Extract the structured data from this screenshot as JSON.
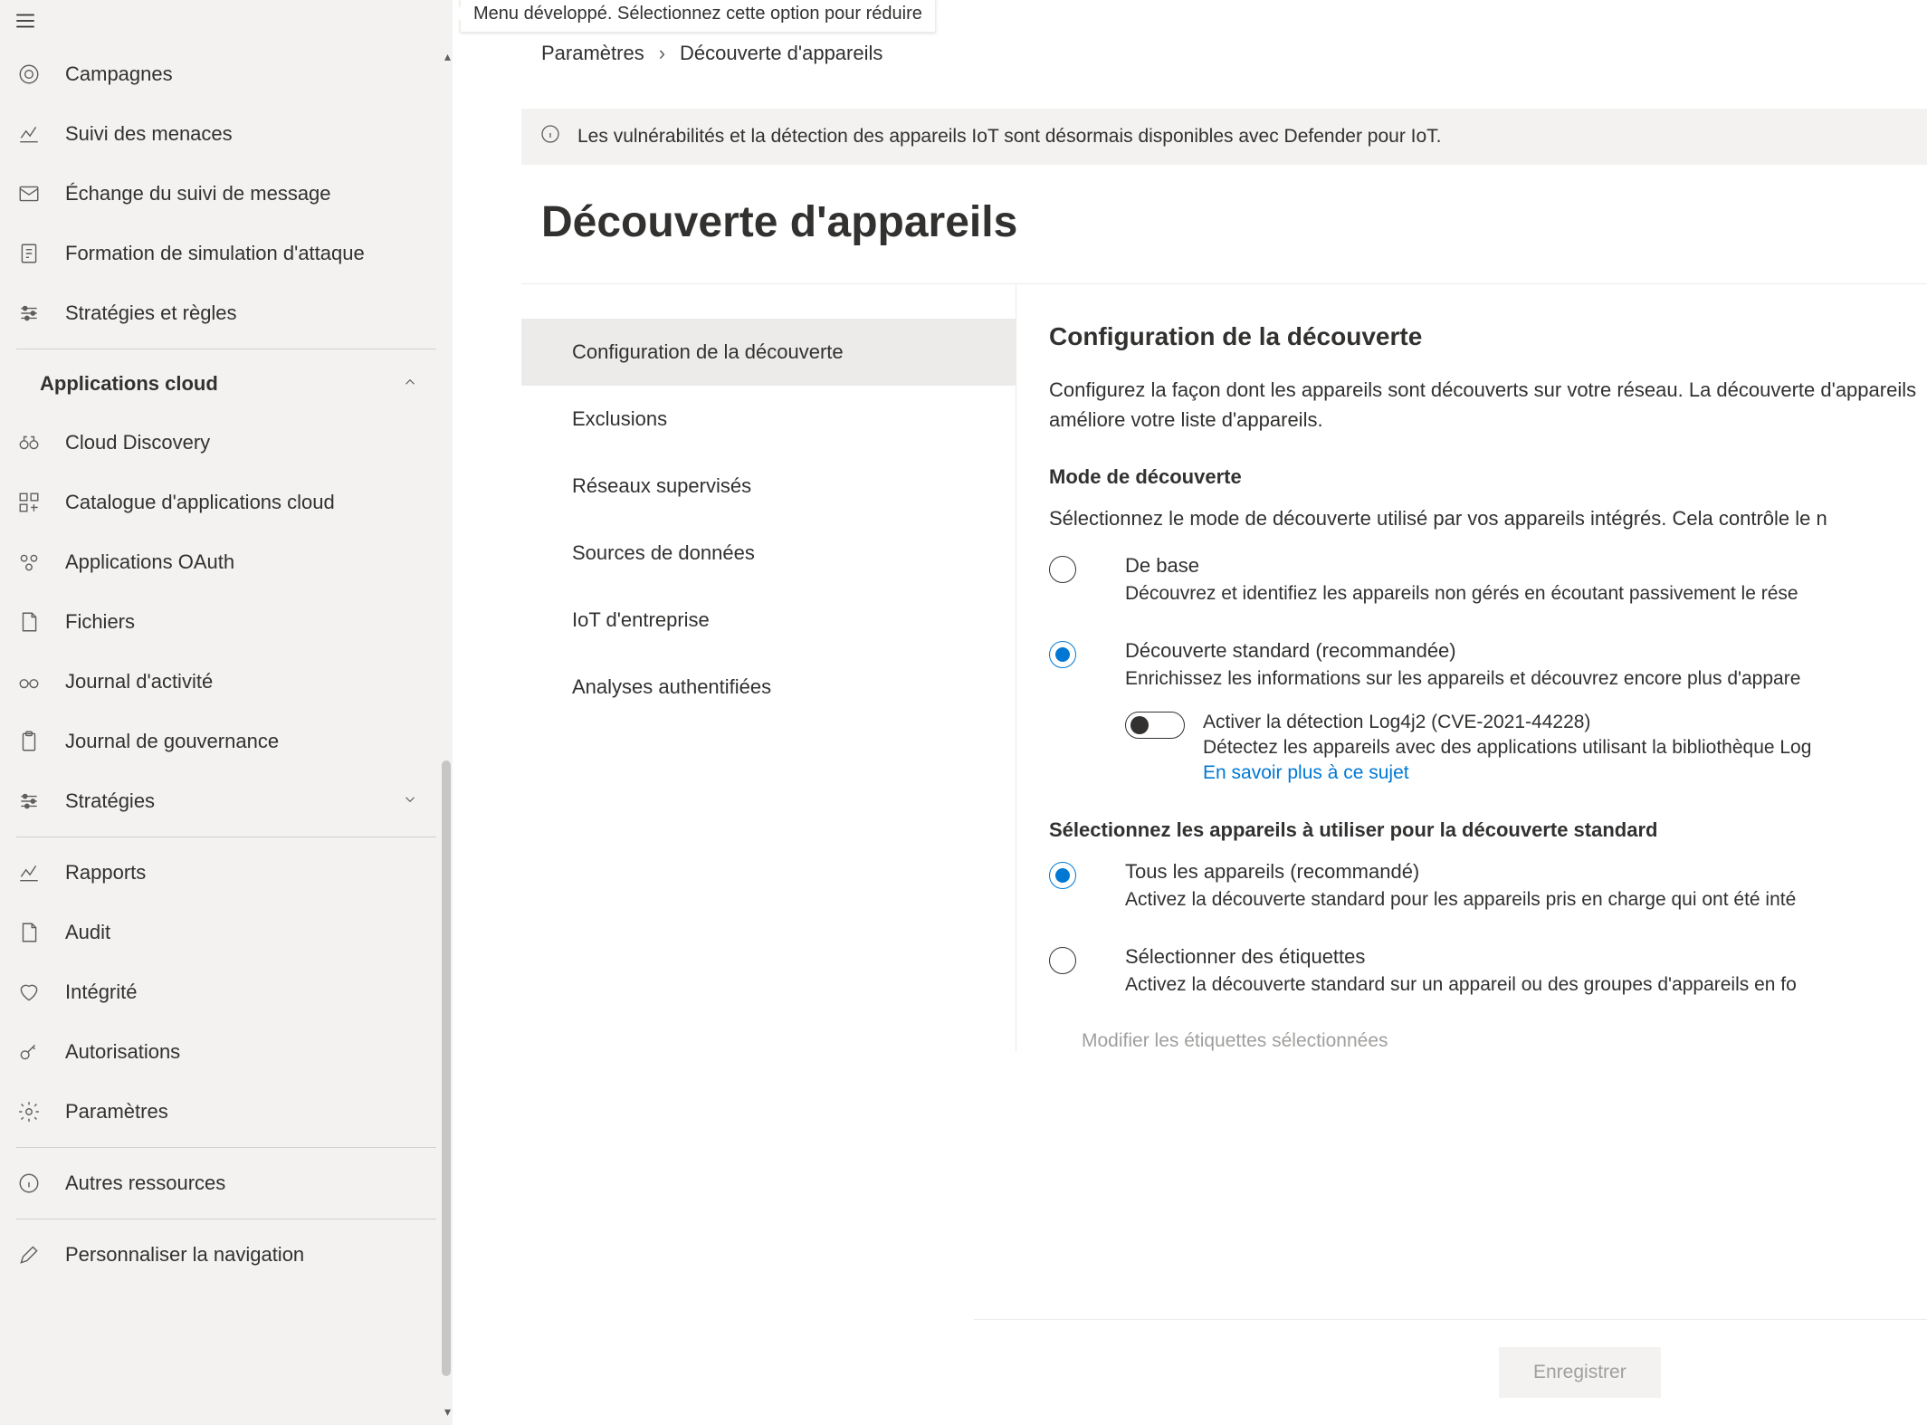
{
  "tooltip": "Menu développé. Sélectionnez cette option pour réduire",
  "sidebar": {
    "items": [
      {
        "icon": "target",
        "label": "Campagnes"
      },
      {
        "icon": "line-chart",
        "label": "Suivi des menaces"
      },
      {
        "icon": "mail-swap",
        "label": "Échange du suivi de message"
      },
      {
        "icon": "doc-arrow",
        "label": "Formation de simulation d'attaque"
      },
      {
        "icon": "sliders",
        "label": "Stratégies et règles"
      }
    ],
    "group_header": "Applications cloud",
    "cloud_items": [
      {
        "icon": "binoculars",
        "label": "Cloud Discovery"
      },
      {
        "icon": "grid-plus",
        "label": "Catalogue d'applications cloud"
      },
      {
        "icon": "oauth",
        "label": "Applications OAuth"
      },
      {
        "icon": "file",
        "label": "Fichiers"
      },
      {
        "icon": "spectacles",
        "label": "Journal d'activité"
      },
      {
        "icon": "clipboard",
        "label": "Journal de gouvernance"
      },
      {
        "icon": "sliders",
        "label": "Stratégies",
        "expandable": true
      }
    ],
    "bottom_items": [
      {
        "icon": "line-chart",
        "label": "Rapports"
      },
      {
        "icon": "file",
        "label": "Audit"
      },
      {
        "icon": "heart",
        "label": "Intégrité"
      },
      {
        "icon": "key",
        "label": "Autorisations"
      },
      {
        "icon": "gear",
        "label": "Paramètres"
      }
    ],
    "footer_items": [
      {
        "icon": "info",
        "label": "Autres ressources"
      },
      {
        "icon": "pencil",
        "label": "Personnaliser la navigation"
      }
    ]
  },
  "breadcrumb": {
    "root": "Paramètres",
    "current": "Découverte d'appareils"
  },
  "info_bar": "Les vulnérabilités et la détection des appareils IoT sont désormais disponibles avec Defender pour IoT.",
  "page_title": "Découverte d'appareils",
  "subnav": [
    "Configuration de la découverte",
    "Exclusions",
    "Réseaux supervisés",
    "Sources de données",
    "IoT d'entreprise",
    "Analyses authentifiées"
  ],
  "detail": {
    "heading": "Configuration de la découverte",
    "lead": "Configurez la façon dont les appareils sont découverts sur votre réseau. La découverte d'appareils améliore votre liste d'appareils.",
    "mode_label": "Mode de découverte",
    "mode_desc": "Sélectionnez le mode de découverte utilisé par vos appareils intégrés. Cela contrôle le n",
    "option_basic_title": "De base",
    "option_basic_desc": "Découvrez et identifiez les appareils non gérés en écoutant passivement le rése",
    "option_standard_title": "Découverte standard (recommandée)",
    "option_standard_desc": "Enrichissez les informations sur les appareils et découvrez encore plus d'appare",
    "toggle_title": "Activer la détection Log4j2 (CVE-2021-44228)",
    "toggle_desc": "Détectez les appareils avec des applications utilisant la bibliothèque Log",
    "toggle_link": "En savoir plus à ce sujet",
    "scope_label": "Sélectionnez les appareils à utiliser pour la découverte standard",
    "scope_all_title": "Tous les appareils (recommandé)",
    "scope_all_desc": "Activez la découverte standard pour les appareils pris en charge qui ont été inté",
    "scope_tags_title": "Sélectionner des étiquettes",
    "scope_tags_desc": "Activez la découverte standard sur un appareil ou des groupes d'appareils en fo",
    "edit_tags": "Modifier les étiquettes sélectionnées",
    "save": "Enregistrer"
  }
}
